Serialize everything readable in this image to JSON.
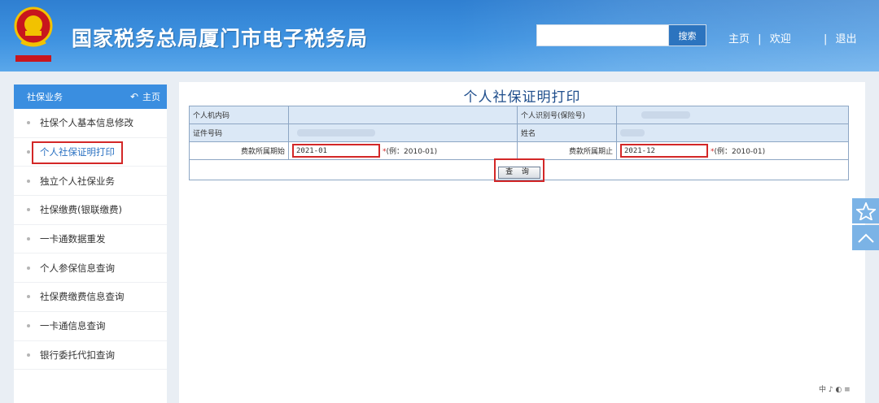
{
  "header": {
    "site_title": "国家税务总局厦门市电子税务局",
    "search": {
      "placeholder": "",
      "button_label": "搜索"
    },
    "links": {
      "home": "主页",
      "welcome": "欢迎",
      "logout": "退出",
      "separator": "|"
    }
  },
  "sidebar": {
    "title": "社保业务",
    "home_label": "主页",
    "items": [
      {
        "label": "社保个人基本信息修改"
      },
      {
        "label": "个人社保证明打印"
      },
      {
        "label": "独立个人社保业务"
      },
      {
        "label": "社保缴费(银联缴费)"
      },
      {
        "label": "一卡通数据重发"
      },
      {
        "label": "个人参保信息查询"
      },
      {
        "label": "社保费缴费信息查询"
      },
      {
        "label": "一卡通信息查询"
      },
      {
        "label": "银行委托代扣查询"
      }
    ],
    "active_index": 1
  },
  "main": {
    "page_title": "个人社保证明打印",
    "fields": {
      "internal_code_label": "个人机内码",
      "id_number_label": "个人识别号(保险号)",
      "cert_number_label": "证件号码",
      "name_label": "姓名",
      "period_start_label": "费款所属期始",
      "period_start_value": "2021-01",
      "period_end_label": "费款所属期止",
      "period_end_value": "2021-12",
      "required_mark": "*",
      "format_hint": "(例：2010-01)"
    },
    "query_button": "查 询"
  },
  "status_bar": {
    "text": "中 ♪ ◐ ≡"
  },
  "colors": {
    "header_blue": "#3e92e0",
    "sidebar_head": "#3a8ee0",
    "highlight_red": "#d32727",
    "title_blue": "#1f4e8c",
    "shaded_row": "#dbe8f6"
  }
}
